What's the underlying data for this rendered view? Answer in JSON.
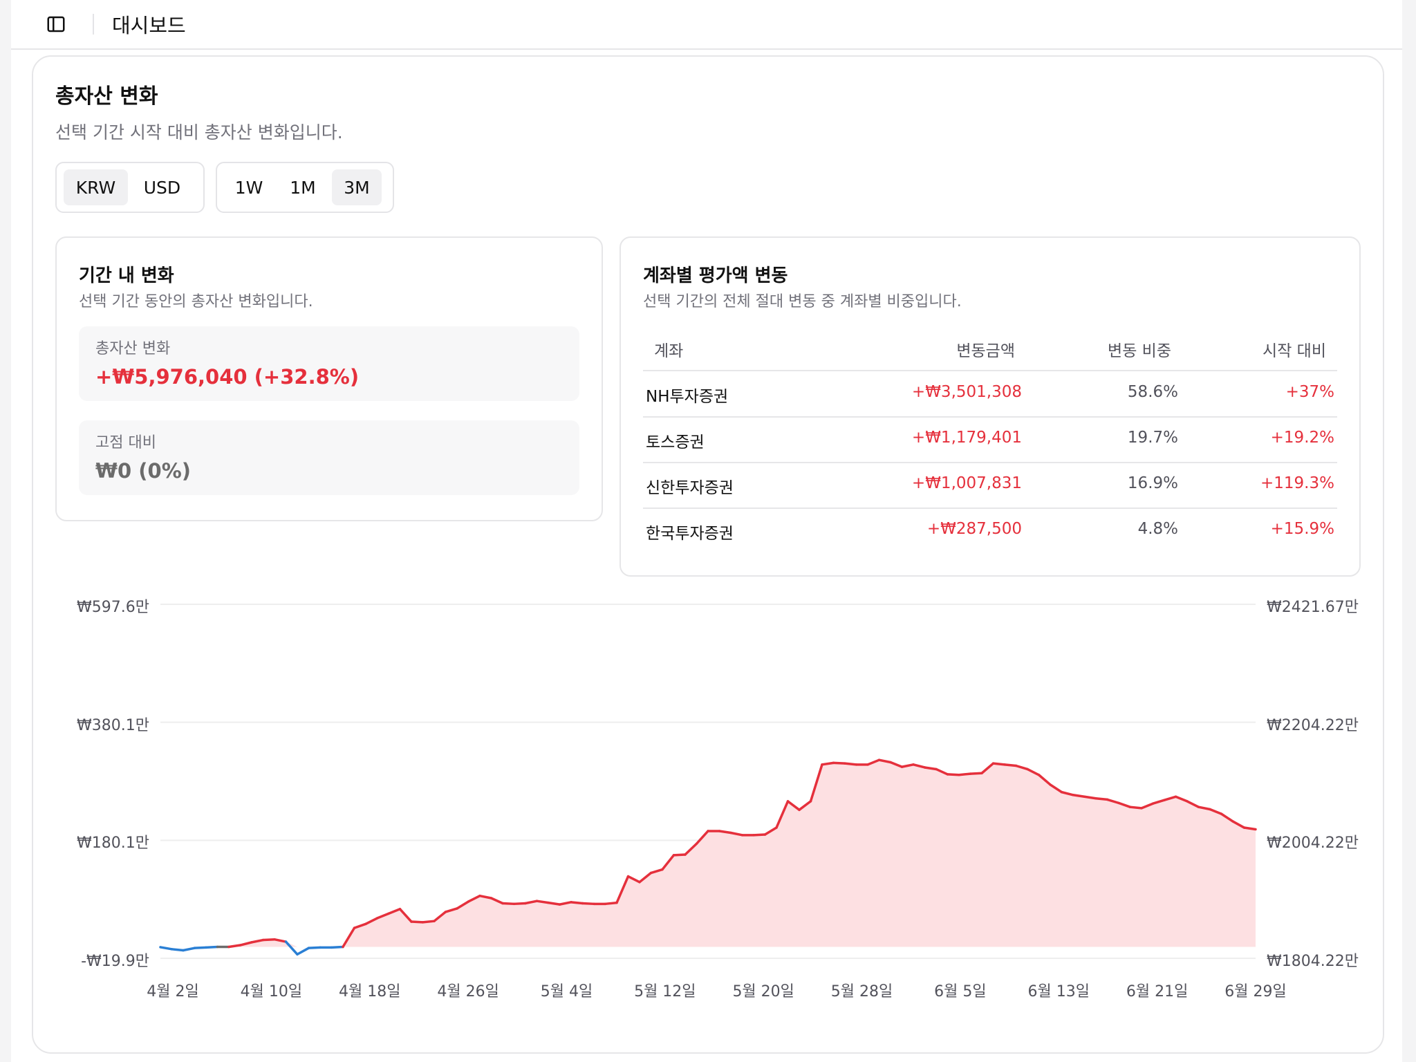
{
  "topbar": {
    "title": "대시보드",
    "toggle_icon": "sidebar-toggle-icon"
  },
  "main": {
    "title": "총자산 변화",
    "description": "선택 기간 시작 대비 총자산 변화입니다.",
    "currency_options": [
      {
        "label": "KRW",
        "active": true
      },
      {
        "label": "USD",
        "active": false
      }
    ],
    "period_options": [
      {
        "label": "1W",
        "active": false
      },
      {
        "label": "1M",
        "active": false
      },
      {
        "label": "3M",
        "active": true
      }
    ]
  },
  "period_change": {
    "title": "기간 내 변화",
    "description": "선택 기간 동안의 총자산 변화입니다.",
    "total_label": "총자산 변화",
    "total_value": "+₩5,976,040 (+32.8%)",
    "fixed_label": "고점 대비",
    "fixed_value": "₩0 (0%)"
  },
  "accounts": {
    "title": "계좌별 평가액 변동",
    "description": "선택 기간의 전체 절대 변동 중 계좌별 비중입니다.",
    "headers": [
      "계좌",
      "변동금액",
      "변동 비중",
      "시작 대비"
    ],
    "rows": [
      [
        "NH투자증권",
        "+₩3,501,308",
        "58.6%",
        "+37%"
      ],
      [
        "토스증권",
        "+₩1,179,401",
        "19.7%",
        "+19.2%"
      ],
      [
        "신한투자증권",
        "+₩1,007,831",
        "16.9%",
        "+119.3%"
      ],
      [
        "한국투자증권",
        "+₩287,500",
        "4.8%",
        "+15.9%"
      ]
    ]
  },
  "colors": {
    "positive": "#e5303c",
    "negative": "#2a7fd4",
    "neutral": "#6b6b6b",
    "area_fill": "#fde0e2"
  },
  "chart_data": {
    "type": "area",
    "ylabels_left": [
      "₩597.6만",
      "₩380.1만",
      "₩180.1만",
      "-₩19.9만"
    ],
    "ylabels_right": [
      "₩2421.67만",
      "₩2204.22만",
      "₩2004.22만",
      "₩1804.22만"
    ],
    "xlabels": [
      "4월 2일",
      "4월 10일",
      "4월 18일",
      "4월 26일",
      "5월 4일",
      "5월 12일",
      "5월 20일",
      "5월 28일",
      "6월 5일",
      "6월 13일",
      "6월 21일",
      "6월 29일"
    ],
    "ylim": [
      -19.9,
      597.6
    ],
    "unit": "만원",
    "series": [
      {
        "values": [
          -0.5,
          -4,
          -6,
          -2,
          -1,
          0,
          0,
          3,
          8,
          12,
          13,
          9,
          -13,
          -2,
          -1,
          -1,
          0,
          33,
          40,
          50,
          58,
          66,
          44,
          43,
          45,
          61,
          67,
          79,
          89,
          85,
          76,
          75,
          76,
          80,
          77,
          74,
          78,
          76,
          75,
          75,
          77,
          123,
          113,
          129,
          135,
          160,
          161,
          180,
          202,
          202,
          199,
          195,
          195,
          196,
          208,
          254,
          239,
          254,
          318,
          321,
          320,
          318,
          318,
          326,
          322,
          314,
          318,
          313,
          310,
          301,
          300,
          302,
          303,
          320,
          318,
          316,
          310,
          300,
          283,
          270,
          265,
          262,
          259,
          257,
          251,
          244,
          242,
          250,
          256,
          262,
          254,
          244,
          240,
          232,
          219,
          208,
          205
        ]
      }
    ]
  }
}
